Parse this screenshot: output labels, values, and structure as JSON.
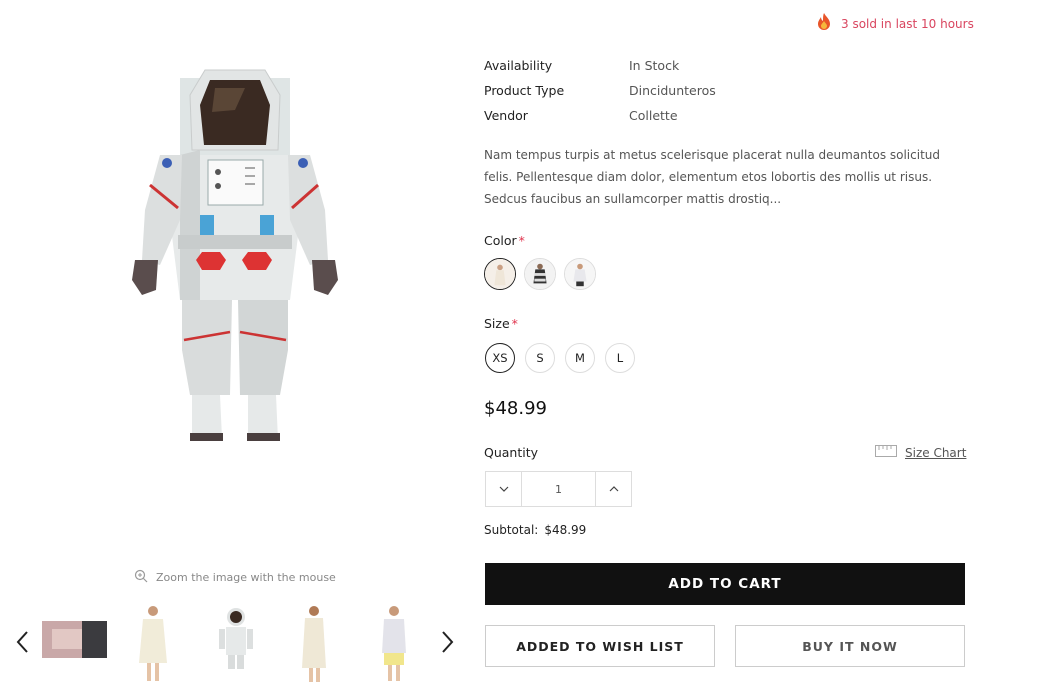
{
  "sold_notice": {
    "icon": "fire-icon",
    "text": "3 sold in last 10 hours"
  },
  "meta": [
    {
      "label": "Availability",
      "value": "In Stock"
    },
    {
      "label": "Product Type",
      "value": "Dincidunteros"
    },
    {
      "label": "Vendor",
      "value": "Collette"
    }
  ],
  "description": "Nam tempus turpis at metus scelerisque placerat nulla deumantos solicitud felis. Pellentesque diam dolor, elementum etos lobortis des mollis ut risus. Sedcus faucibus an sullamcorper mattis drostiq...",
  "color": {
    "label": "Color",
    "required_mark": "*",
    "selected_index": 0
  },
  "size": {
    "label": "Size",
    "required_mark": "*",
    "options": [
      "XS",
      "S",
      "M",
      "L"
    ],
    "selected": "XS"
  },
  "price": "$48.99",
  "quantity": {
    "label": "Quantity",
    "value": "1"
  },
  "size_chart": {
    "label": "Size Chart",
    "icon": "ruler-icon"
  },
  "subtotal": {
    "label": "Subtotal:",
    "value": "$48.99"
  },
  "buttons": {
    "add_to_cart": "ADD TO CART",
    "wishlist": "ADDED TO WISH LIST",
    "buy_now": "BUY IT NOW"
  },
  "gallery": {
    "zoom_hint": "Zoom the image with the mouse",
    "zoom_icon": "zoom-in-icon",
    "prev_icon": "chevron-left-icon",
    "next_icon": "chevron-right-icon"
  },
  "colors": {
    "accent_red": "#d9455f",
    "button_black": "#111111"
  }
}
